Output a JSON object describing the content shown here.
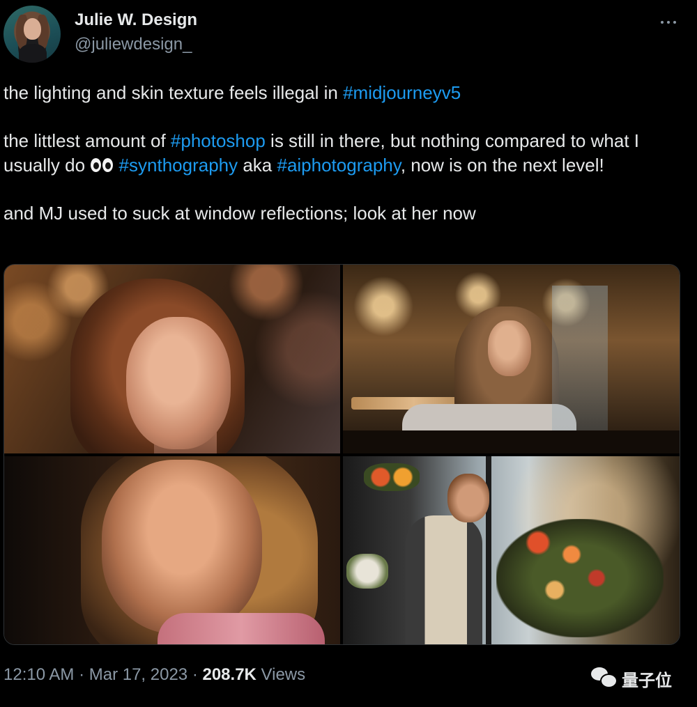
{
  "author": {
    "display_name": "Julie W. Design",
    "handle": "@juliewdesign_",
    "avatar_icon": "avatar-photo"
  },
  "tweet": {
    "line1": {
      "text": "the lighting and skin texture feels illegal in ",
      "hashtag": "#midjourneyv5"
    },
    "para2": {
      "t1": "the littlest amount of ",
      "h1": "#photoshop",
      "t2": " is still in there, but nothing compared to what I usually do ",
      "emoji": "eyes-emoji",
      "t3": " ",
      "h2": "#synthography",
      "t4": " aka ",
      "h3": "#aiphotography",
      "t5": ", now is on the next level!"
    },
    "para3": {
      "text": "and MJ used to suck at window reflections; look at her now"
    }
  },
  "media": [
    {
      "icon": "portrait-curly-hair-photo"
    },
    {
      "icon": "bakery-window-photo"
    },
    {
      "icon": "closeup-portrait-photo"
    },
    {
      "icon": "florist-photo"
    }
  ],
  "meta": {
    "time": "12:10 AM",
    "separator1": " · ",
    "date": "Mar 17, 2023",
    "separator2": " · ",
    "views_count": "208.7K",
    "views_label": " Views"
  },
  "watermark": {
    "text": "量子位",
    "icon": "wechat-icon"
  },
  "colors": {
    "background": "#000000",
    "text": "#e7e9ea",
    "secondary": "#8b98a5",
    "link": "#1d9bf0"
  }
}
